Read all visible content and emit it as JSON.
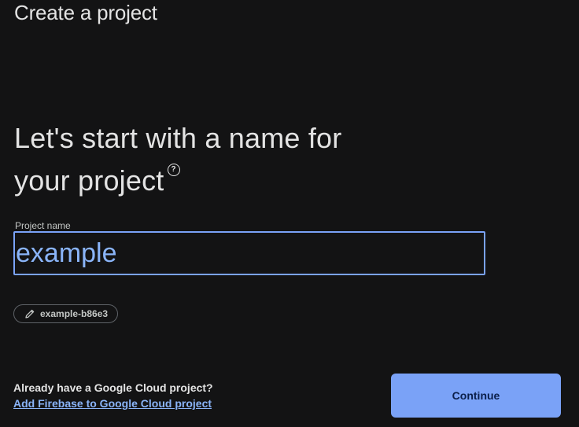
{
  "header": {
    "title": "Create a project"
  },
  "main": {
    "headline_line1": "Let's start with a name for",
    "headline_line2": "your project",
    "help_icon_glyph": "?",
    "project_name": {
      "label": "Project name",
      "value": "example"
    },
    "project_id_chip": {
      "icon": "pencil-icon",
      "label": "example-b86e3"
    }
  },
  "footer": {
    "question": "Already have a Google Cloud project?",
    "link": "Add Firebase to Google Cloud project",
    "continue_label": "Continue"
  },
  "colors": {
    "background": "#131314",
    "accent": "#7aa2f7",
    "link": "#8ab4f8",
    "text": "#e3e3e3"
  }
}
